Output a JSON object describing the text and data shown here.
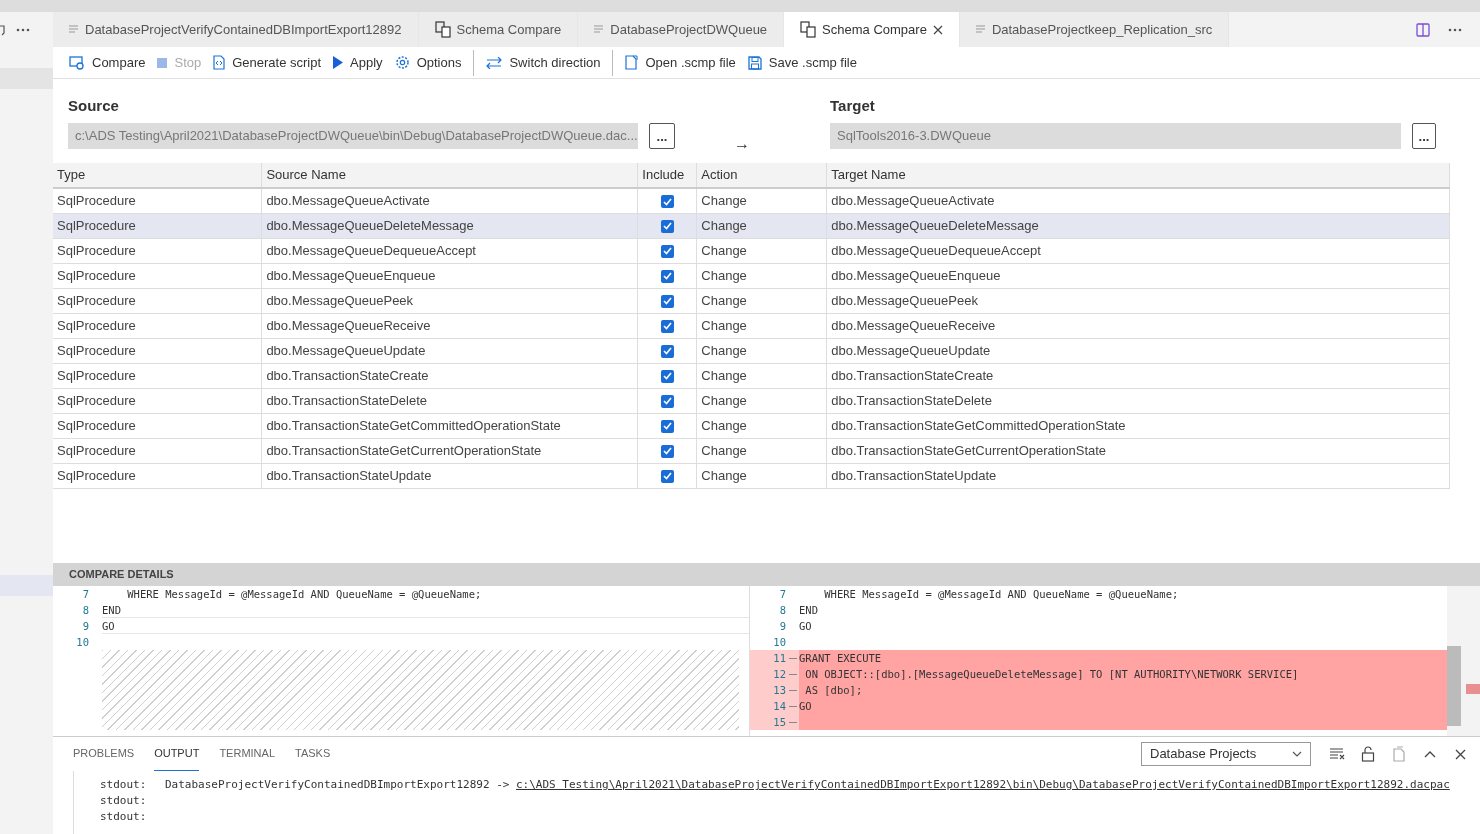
{
  "tabs": [
    {
      "label": "DatabaseProjectVerifyContainedDBImportExport12892",
      "kind": "file",
      "selected": false,
      "closable": false
    },
    {
      "label": "Schema Compare",
      "kind": "compare",
      "selected": false,
      "closable": false
    },
    {
      "label": "DatabaseProjectDWQueue",
      "kind": "file",
      "selected": false,
      "closable": false
    },
    {
      "label": "Schema Compare",
      "kind": "compare",
      "selected": true,
      "closable": true
    },
    {
      "label": "DatabaseProjectkeep_Replication_src",
      "kind": "file",
      "selected": false,
      "closable": false
    }
  ],
  "toolbar": [
    {
      "label": "Compare",
      "kind": "compare",
      "disabled": false
    },
    {
      "label": "Stop",
      "kind": "stop",
      "disabled": true
    },
    {
      "label": "Generate script",
      "kind": "script",
      "disabled": false
    },
    {
      "label": "Apply",
      "kind": "apply",
      "disabled": false
    },
    {
      "label": "Options",
      "kind": "options",
      "disabled": false,
      "separator_after": true
    },
    {
      "label": "Switch direction",
      "kind": "switch",
      "disabled": false,
      "separator_after": true
    },
    {
      "label": "Open .scmp file",
      "kind": "open",
      "disabled": false
    },
    {
      "label": "Save .scmp file",
      "kind": "save",
      "disabled": false
    }
  ],
  "source": {
    "heading": "Source",
    "value": "c:\\ADS Testing\\April2021\\DatabaseProjectDWQueue\\bin\\Debug\\DatabaseProjectDWQueue.dac...",
    "browse": "..."
  },
  "arrow": "→",
  "target": {
    "heading": "Target",
    "value": "SqlTools2016-3.DWQueue",
    "browse": "..."
  },
  "table": {
    "columns": [
      "Type",
      "Source Name",
      "Include",
      "Action",
      "Target Name"
    ],
    "rows": [
      {
        "type": "SqlProcedure",
        "source": "dbo.MessageQueueActivate",
        "included": true,
        "action": "Change",
        "target": "dbo.MessageQueueActivate",
        "selected": false
      },
      {
        "type": "SqlProcedure",
        "source": "dbo.MessageQueueDeleteMessage",
        "included": true,
        "action": "Change",
        "target": "dbo.MessageQueueDeleteMessage",
        "selected": true
      },
      {
        "type": "SqlProcedure",
        "source": "dbo.MessageQueueDequeueAccept",
        "included": true,
        "action": "Change",
        "target": "dbo.MessageQueueDequeueAccept",
        "selected": false
      },
      {
        "type": "SqlProcedure",
        "source": "dbo.MessageQueueEnqueue",
        "included": true,
        "action": "Change",
        "target": "dbo.MessageQueueEnqueue",
        "selected": false
      },
      {
        "type": "SqlProcedure",
        "source": "dbo.MessageQueuePeek",
        "included": true,
        "action": "Change",
        "target": "dbo.MessageQueuePeek",
        "selected": false
      },
      {
        "type": "SqlProcedure",
        "source": "dbo.MessageQueueReceive",
        "included": true,
        "action": "Change",
        "target": "dbo.MessageQueueReceive",
        "selected": false
      },
      {
        "type": "SqlProcedure",
        "source": "dbo.MessageQueueUpdate",
        "included": true,
        "action": "Change",
        "target": "dbo.MessageQueueUpdate",
        "selected": false
      },
      {
        "type": "SqlProcedure",
        "source": "dbo.TransactionStateCreate",
        "included": true,
        "action": "Change",
        "target": "dbo.TransactionStateCreate",
        "selected": false
      },
      {
        "type": "SqlProcedure",
        "source": "dbo.TransactionStateDelete",
        "included": true,
        "action": "Change",
        "target": "dbo.TransactionStateDelete",
        "selected": false
      },
      {
        "type": "SqlProcedure",
        "source": "dbo.TransactionStateGetCommittedOperationState",
        "included": true,
        "action": "Change",
        "target": "dbo.TransactionStateGetCommittedOperationState",
        "selected": false
      },
      {
        "type": "SqlProcedure",
        "source": "dbo.TransactionStateGetCurrentOperationState",
        "included": true,
        "action": "Change",
        "target": "dbo.TransactionStateGetCurrentOperationState",
        "selected": false
      },
      {
        "type": "SqlProcedure",
        "source": "dbo.TransactionStateUpdate",
        "included": true,
        "action": "Change",
        "target": "dbo.TransactionStateUpdate",
        "selected": false
      }
    ]
  },
  "compare_details": {
    "title": "COMPARE DETAILS",
    "left": [
      {
        "kind": "normal",
        "number": "7",
        "text": "    WHERE MessageId = @MessageId AND QueueName = @QueueName;"
      },
      {
        "kind": "normal",
        "number": "8",
        "text": "END"
      },
      {
        "kind": "normal",
        "number": "9",
        "text": "GO"
      },
      {
        "kind": "normal",
        "number": "10"
      },
      {
        "kind": "filler"
      }
    ],
    "right": [
      {
        "kind": "normal",
        "number": "7",
        "text": "    WHERE MessageId = @MessageId AND QueueName = @QueueName;"
      },
      {
        "kind": "normal",
        "number": "8",
        "text": "END"
      },
      {
        "kind": "normal",
        "number": "9",
        "text": "GO"
      },
      {
        "kind": "normal",
        "number": "10"
      },
      {
        "kind": "added",
        "number": "11",
        "text": "GRANT EXECUTE"
      },
      {
        "kind": "added",
        "number": "12",
        "text": " ON OBJECT::[dbo].[MessageQueueDeleteMessage] TO [NT AUTHORITY\\NETWORK SERVICE]"
      },
      {
        "kind": "added",
        "number": "13",
        "text": " AS [dbo];"
      },
      {
        "kind": "added",
        "number": "14",
        "text": "GO"
      },
      {
        "kind": "added",
        "number": "15"
      }
    ]
  },
  "panel": {
    "tabs": [
      {
        "label": "PROBLEMS",
        "selected": false
      },
      {
        "label": "OUTPUT",
        "selected": true
      },
      {
        "label": "TERMINAL",
        "selected": false
      },
      {
        "label": "TASKS",
        "selected": false
      }
    ],
    "channel": "Database Projects",
    "output": [
      {
        "prefix": "stdout:",
        "text": "DatabaseProjectVerifyContainedDBImportExport12892 -> ",
        "link": "c:\\ADS Testing\\April2021\\DatabaseProjectVerifyContainedDBImportExport12892\\bin\\Debug\\DatabaseProjectVerifyContainedDBImportExport12892.dacpac"
      },
      {
        "prefix": "stdout:"
      },
      {
        "prefix": "stdout:"
      }
    ]
  }
}
